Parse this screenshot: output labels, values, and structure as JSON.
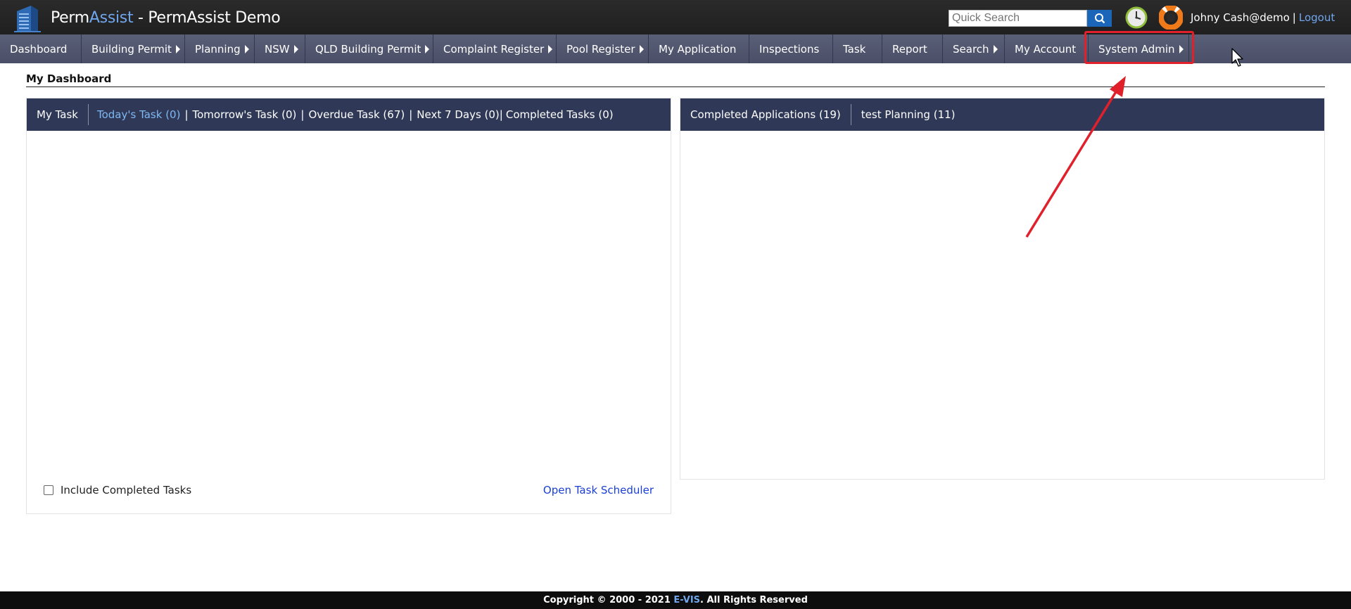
{
  "app": {
    "brand_part1": "Perm",
    "brand_part2": "Assist",
    "brand_rest": " - PermAssist Demo"
  },
  "header": {
    "search_placeholder": "Quick Search",
    "user_name": "Johny Cash@demo",
    "separator": "|",
    "logout_label": "Logout",
    "icons": [
      "search-icon",
      "clock-icon",
      "help-lifebuoy-icon"
    ]
  },
  "nav": {
    "items": [
      {
        "label": "Dashboard",
        "submenu": false
      },
      {
        "label": "Building Permit",
        "submenu": true
      },
      {
        "label": "Planning",
        "submenu": true
      },
      {
        "label": "NSW",
        "submenu": true
      },
      {
        "label": "QLD Building Permit",
        "submenu": true
      },
      {
        "label": "Complaint Register",
        "submenu": true
      },
      {
        "label": "Pool Register",
        "submenu": true
      },
      {
        "label": "My Application",
        "submenu": false
      },
      {
        "label": "Inspections",
        "submenu": false
      },
      {
        "label": "Task",
        "submenu": false
      },
      {
        "label": "Report",
        "submenu": false
      },
      {
        "label": "Search",
        "submenu": true
      },
      {
        "label": "My Account",
        "submenu": false
      },
      {
        "label": "System Admin",
        "submenu": true
      }
    ]
  },
  "page": {
    "title": "My Dashboard"
  },
  "task_panel": {
    "header": "My Task",
    "tabs": [
      {
        "label": "Today's Task (0)",
        "active": true
      },
      {
        "label": "Tomorrow's Task (0)",
        "active": false
      },
      {
        "label": "Overdue Task (67)",
        "active": false
      },
      {
        "label": "Next 7 Days (0)",
        "active": false
      },
      {
        "label": "Completed Tasks (0)",
        "active": false
      }
    ],
    "include_completed_label": "Include Completed Tasks",
    "include_completed_checked": false,
    "scheduler_link": "Open Task Scheduler"
  },
  "applications_panel": {
    "tabs": [
      {
        "label": "Completed Applications (19)"
      },
      {
        "label": "test Planning (11)"
      }
    ]
  },
  "footer": {
    "text_before": "Copyright © 2000 - 2021 ",
    "company": "E-VIS",
    "text_after": ". All Rights Reserved"
  },
  "colors": {
    "header_bg": "#1f1f1f",
    "nav_bg": "#4a4f67",
    "panel_head_bg": "#2f3957",
    "accent_blue": "#6fa6ee",
    "highlight_red": "#e0202a"
  }
}
